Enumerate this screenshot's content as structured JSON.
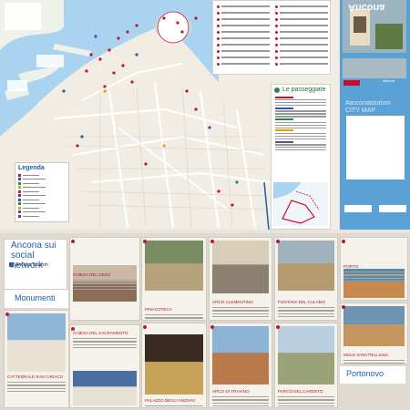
{
  "cover": {
    "title": "Ancona",
    "hashtag": "#anconatourism CITY MAP",
    "logo_text": "Marche"
  },
  "legend": {
    "title": "Legenda",
    "swatch_colors": [
      "#c8102e",
      "#1d5fa6",
      "#2d8a4e",
      "#e6a100",
      "#7a3f9d",
      "#c8102e",
      "#1d5fa6",
      "#2d8a4e",
      "#e6a100",
      "#7a3f9d",
      "#555555"
    ]
  },
  "walks": {
    "title": "Le passeggiate",
    "marker_colors": [
      "#c8102e",
      "#1d5fa6",
      "#2d8a4e",
      "#e6a100",
      "#7a3f9d"
    ]
  },
  "social": {
    "title": "Ancona sui social network",
    "handle": "Ancona Tourism"
  },
  "sections": {
    "monumenti": "Monumenti",
    "portonovo": "Portonovo"
  },
  "cards": [
    {
      "title": "CHIESA DEL GESÙ"
    },
    {
      "title": "CHIESA SANTA MARIA DELLA PIAZZA"
    },
    {
      "title": "PINACOTECA"
    },
    {
      "title": "PIAZZA DEL PLEBISCITO"
    },
    {
      "title": "ARCO CLEMENTINO"
    },
    {
      "title": "FONTANA DEL CALAMO"
    },
    {
      "title": "PORTO"
    },
    {
      "title": "MOLE VANVITELLIANA"
    },
    {
      "title": "CATTEDRALE SAN CIRIACO"
    },
    {
      "title": "CHIESA DEL SACRAMENTO"
    },
    {
      "title": "PALAZZO DEGLI ANZIANI"
    },
    {
      "title": "ARCO DI TRAIANO"
    },
    {
      "title": "PARCO DEL CARDETO"
    }
  ]
}
